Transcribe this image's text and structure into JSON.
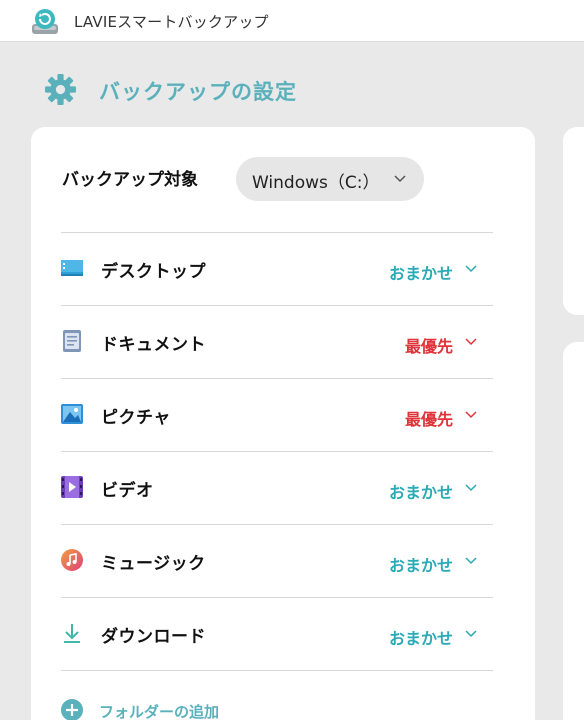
{
  "app": {
    "title": "LAVIEスマートバックアップ"
  },
  "heading": {
    "title": "バックアップの設定"
  },
  "target": {
    "label": "バックアップ対象",
    "drive_value": "Windows（C:）"
  },
  "rows": [
    {
      "label": "デスクトップ",
      "priority": "おまかせ",
      "icon": "desktop-icon"
    },
    {
      "label": "ドキュメント",
      "priority": "最優先",
      "icon": "document-icon"
    },
    {
      "label": "ピクチャ",
      "priority": "最優先",
      "icon": "picture-icon"
    },
    {
      "label": "ビデオ",
      "priority": "おまかせ",
      "icon": "video-icon"
    },
    {
      "label": "ミュージック",
      "priority": "おまかせ",
      "icon": "music-icon"
    },
    {
      "label": "ダウンロード",
      "priority": "おまかせ",
      "icon": "download-icon"
    }
  ],
  "add_folder": {
    "label": "フォルダーの追加"
  },
  "colors": {
    "accent": "#5ab1bb",
    "priority_normal": "#2aa9b6",
    "priority_high": "#e0343a"
  }
}
